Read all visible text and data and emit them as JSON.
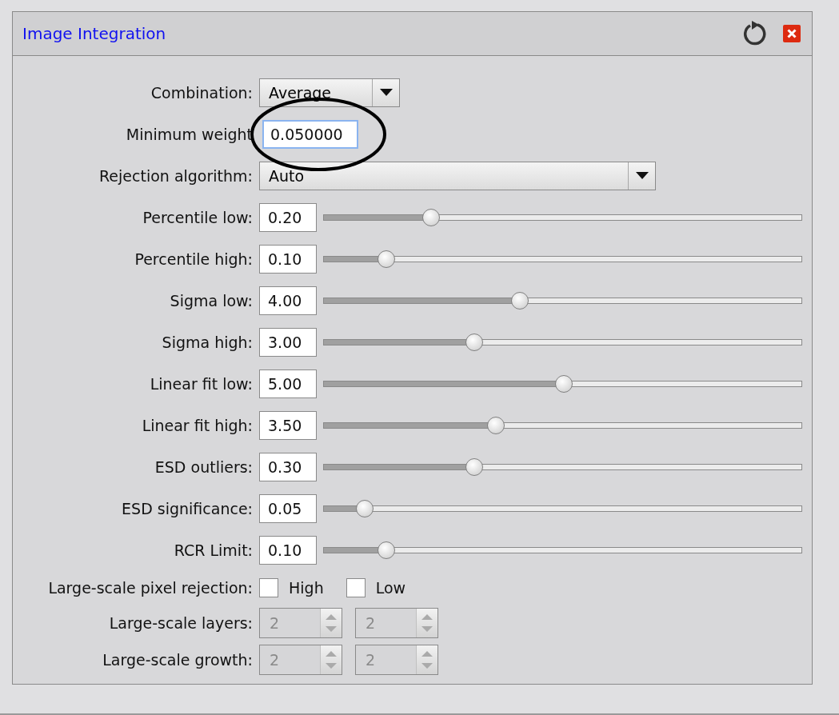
{
  "panel": {
    "title": "Image Integration"
  },
  "rows": [
    {
      "kind": "combo",
      "label": "Combination:",
      "value": "Average"
    },
    {
      "kind": "number",
      "label": "Minimum weight",
      "value": "0.050000",
      "focused": true
    },
    {
      "kind": "dropdown",
      "label": "Rejection algorithm:",
      "value": "Auto"
    },
    {
      "kind": "slider",
      "label": "Percentile low:",
      "value": "0.20",
      "level": 0.224
    },
    {
      "kind": "slider",
      "label": "Percentile high:",
      "value": "0.10",
      "level": 0.13
    },
    {
      "kind": "slider",
      "label": "Sigma low:",
      "value": "4.00",
      "level": 0.41
    },
    {
      "kind": "slider",
      "label": "Sigma high:",
      "value": "3.00",
      "level": 0.315
    },
    {
      "kind": "slider",
      "label": "Linear fit low:",
      "value": "5.00",
      "level": 0.503
    },
    {
      "kind": "slider",
      "label": "Linear fit high:",
      "value": "3.50",
      "level": 0.36
    },
    {
      "kind": "slider",
      "label": "ESD outliers:",
      "value": "0.30",
      "level": 0.315
    },
    {
      "kind": "slider",
      "label": "ESD significance:",
      "value": "0.05",
      "level": 0.085
    },
    {
      "kind": "slider",
      "label": "RCR Limit:",
      "value": "0.10",
      "level": 0.13
    },
    {
      "kind": "checkboxes",
      "label": "Large-scale pixel rejection:",
      "options": [
        {
          "label": "High",
          "checked": false
        },
        {
          "label": "Low",
          "checked": false
        }
      ]
    },
    {
      "kind": "spinners",
      "label": "Large-scale layers:",
      "disabled": true,
      "values": [
        "2",
        "2"
      ]
    },
    {
      "kind": "spinners",
      "label": "Large-scale growth:",
      "disabled": true,
      "values": [
        "2",
        "2"
      ]
    }
  ]
}
